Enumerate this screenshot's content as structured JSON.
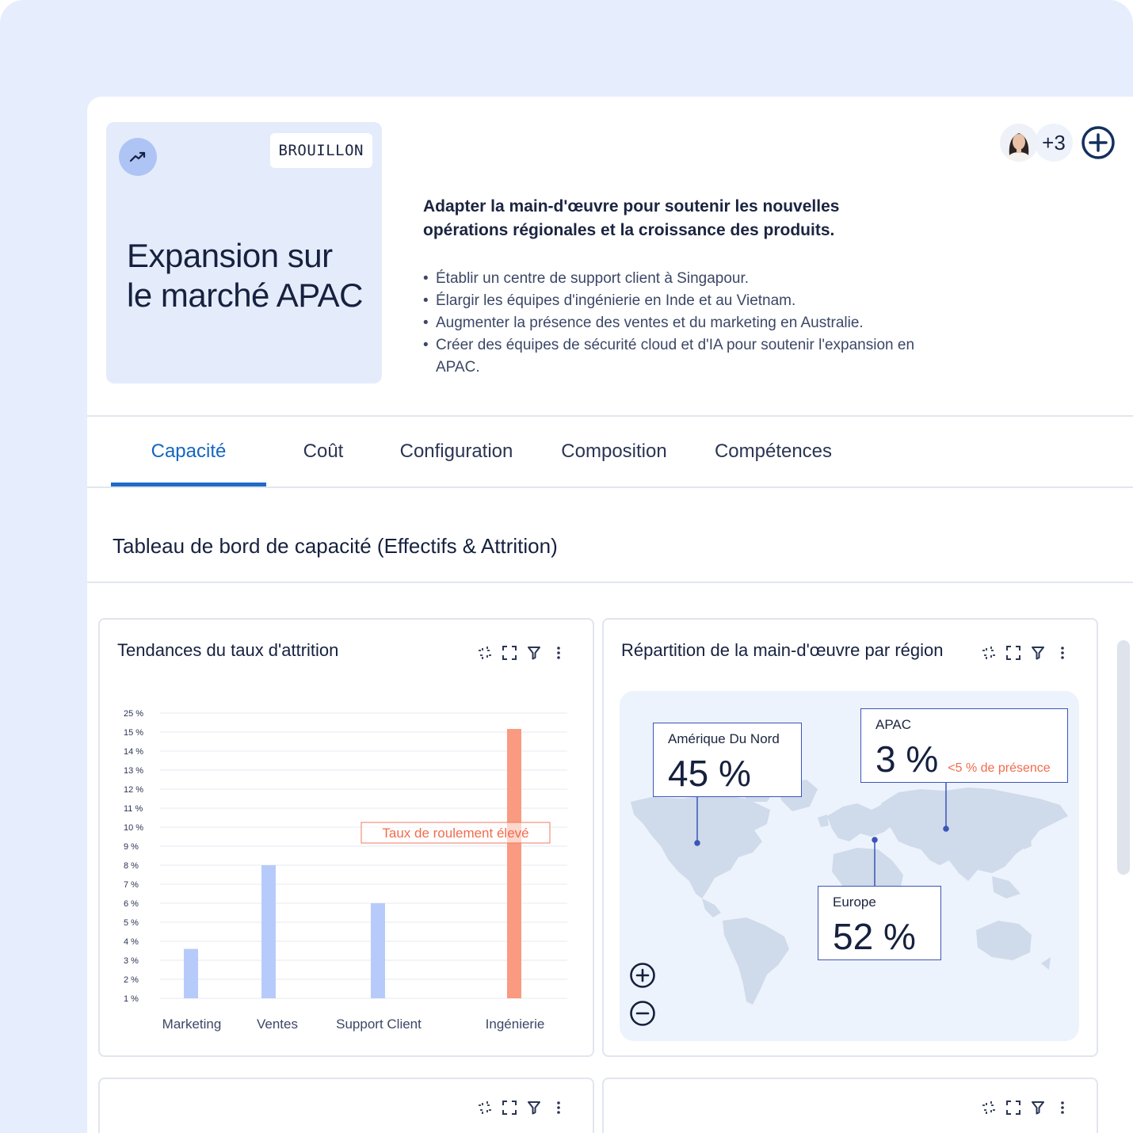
{
  "hero": {
    "badge": "BROUILLON",
    "title": "Expansion sur le marché APAC",
    "icon": "trending-up-icon"
  },
  "summary": {
    "headline": "Adapter la main-d'œuvre pour soutenir les nouvelles opérations régionales et la croissance des produits.",
    "bullets": [
      "Établir un centre de support client à Singapour.",
      "Élargir les équipes d'ingénierie en Inde et au Vietnam.",
      "Augmenter la présence des ventes et du marketing en Australie.",
      "Créer des équipes de sécurité cloud et d'IA pour soutenir l'expansion en APAC."
    ]
  },
  "collaborators": {
    "more_count": "+3"
  },
  "tabs": [
    {
      "label": "Capacité",
      "active": true
    },
    {
      "label": "Coût",
      "active": false
    },
    {
      "label": "Configuration",
      "active": false
    },
    {
      "label": "Composition",
      "active": false
    },
    {
      "label": "Compétences",
      "active": false
    }
  ],
  "section_title": "Tableau de bord de capacité (Effectifs & Attrition)",
  "attrition_card": {
    "title": "Tendances du taux d'attrition",
    "annotation": "Taux de roulement élevé"
  },
  "region_card": {
    "title": "Répartition de la main-d'œuvre par région",
    "callouts": [
      {
        "label": "Amérique Du Nord",
        "value": "45 %"
      },
      {
        "label": "APAC",
        "value": "3 %",
        "note": "<5 % de présence"
      },
      {
        "label": "Europe",
        "value": "52 %"
      }
    ]
  },
  "colors": {
    "accent": "#1f6bc6",
    "bar_default": "#b7cbfa",
    "bar_highlight": "#fa9a80",
    "warning": "#f26b4c"
  },
  "chart_data": {
    "type": "bar",
    "title": "Tendances du taux d'attrition",
    "categories": [
      "Marketing",
      "Ventes",
      "Support Client",
      "Ingénierie"
    ],
    "values": [
      3.6,
      8.0,
      6.0,
      15.2
    ],
    "y_ticks": [
      "1 %",
      "2 %",
      "3 %",
      "4 %",
      "5 %",
      "6 %",
      "7 %",
      "8 %",
      "9 %",
      "10 %",
      "11 %",
      "12 %",
      "13 %",
      "14 %",
      "15 %",
      "25 %"
    ],
    "highlight_category": "Ingénierie",
    "grid": true
  }
}
